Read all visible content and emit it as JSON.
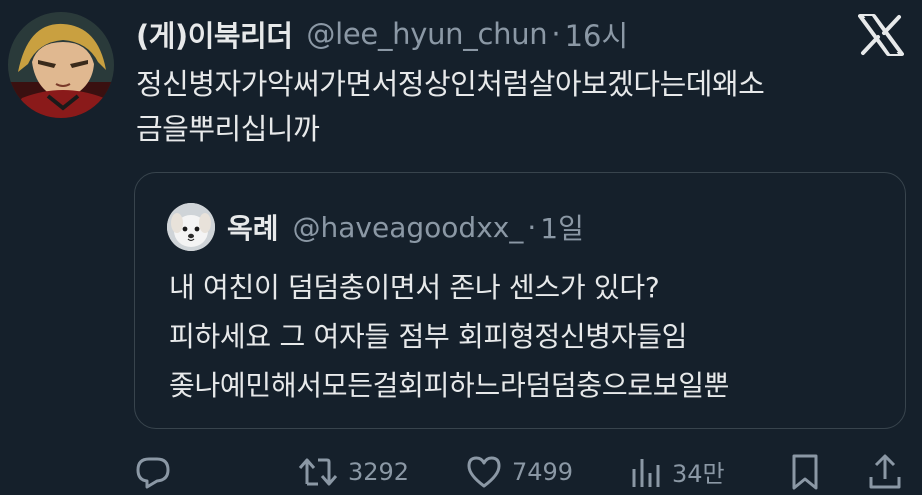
{
  "tweet": {
    "display_name": "(게)이북리더",
    "handle": "@lee_hyun_chun",
    "separator": "·",
    "time": "16시",
    "text_lines": [
      "정신병자가악써가면서정상인처럼살아보겠다는데왜소",
      "금을뿌리십니까"
    ],
    "avatar_icon": "anime-character-avatar",
    "logo_icon": "x-logo-icon"
  },
  "quote": {
    "display_name": "옥례",
    "handle": "@haveagoodxx_",
    "separator": "·",
    "time": "1일",
    "text_lines": [
      "내 여친이 덤덤충이면서 존나 센스가 있다?",
      "피하세요 그 여자들 점부 회피형정신병자들임",
      "좆나예민해서모든걸회피하느라덤덤충으로보일뿐"
    ],
    "avatar_icon": "white-puppy-avatar"
  },
  "actions": {
    "reply_icon": "reply-icon",
    "retweet_icon": "retweet-icon",
    "retweet_count": "3292",
    "like_icon": "heart-icon",
    "like_count": "7499",
    "views_icon": "views-chart-icon",
    "views_count": "34만",
    "bookmark_icon": "bookmark-icon",
    "share_icon": "share-icon"
  },
  "colors": {
    "background": "#15202b",
    "text_primary": "#e7e9ea",
    "text_secondary": "#8b98a5",
    "border": "#38444d"
  }
}
